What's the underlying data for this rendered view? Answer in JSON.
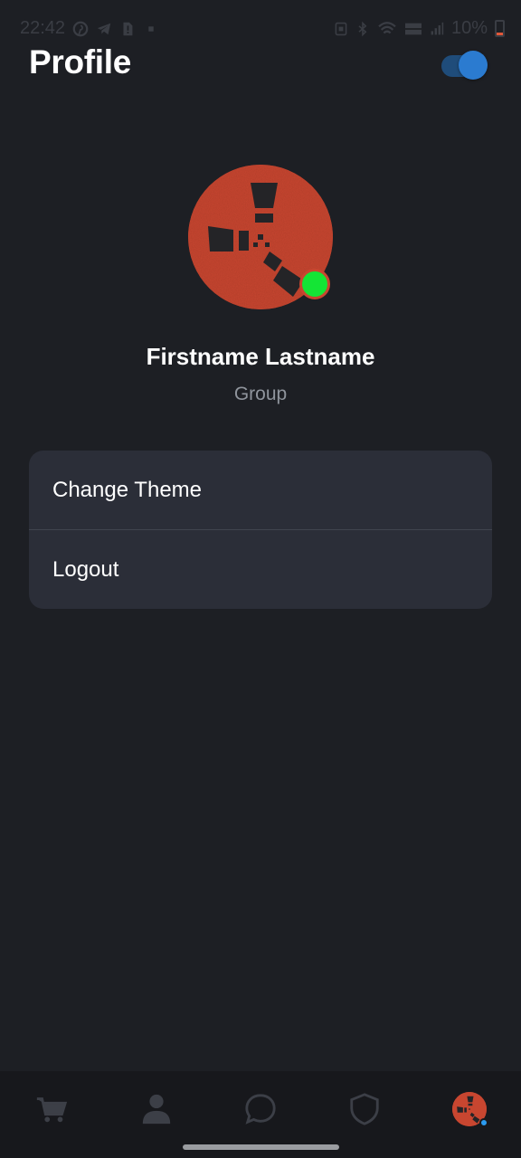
{
  "status_bar": {
    "time": "22:42",
    "battery_text": "10%",
    "left_icons": [
      "pinterest-icon",
      "telegram-icon",
      "sim-alert-icon",
      "dot-icon"
    ],
    "right_icons": [
      "nfc-icon",
      "bluetooth-icon",
      "wifi-icon",
      "volte-wifi-icon",
      "signal-icon",
      "battery-icon"
    ]
  },
  "header": {
    "title": "Profile",
    "theme_toggle_on": true
  },
  "profile": {
    "name": "Firstname Lastname",
    "group": "Group",
    "status": "online",
    "avatar_icon": "rust-logo-icon"
  },
  "menu": {
    "items": [
      {
        "label": "Change Theme"
      },
      {
        "label": "Logout"
      }
    ]
  },
  "bottom_nav": {
    "items": [
      {
        "icon": "cart-icon",
        "active": false
      },
      {
        "icon": "user-icon",
        "active": false
      },
      {
        "icon": "chat-bubble-icon",
        "active": false
      },
      {
        "icon": "shield-icon",
        "active": false
      },
      {
        "icon": "profile-avatar-icon",
        "active": true
      }
    ]
  },
  "colors": {
    "background": "#1d1f24",
    "card": "#2b2e38",
    "accent": "#2b7bd0",
    "avatar": "#c84630",
    "online": "#14e535",
    "muted_text": "#8f949c",
    "nav_background": "#17181c",
    "nav_icon": "#3c3f47"
  }
}
